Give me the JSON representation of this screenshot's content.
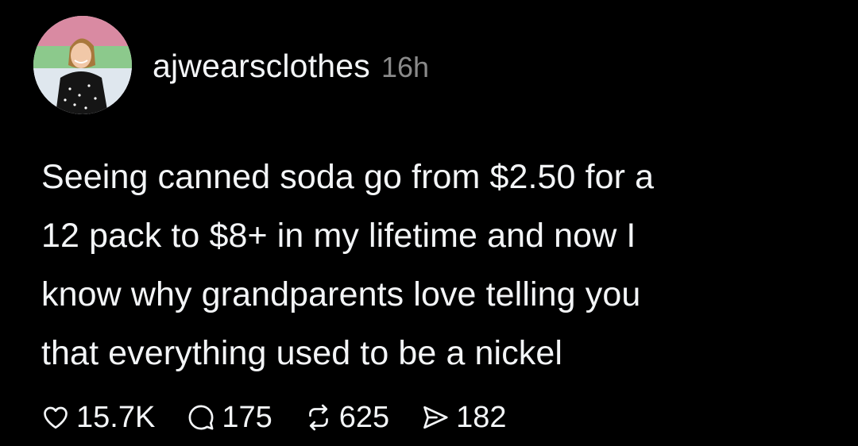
{
  "post": {
    "author": {
      "username": "ajwearsclothes",
      "avatar_icon": "profile-photo"
    },
    "timestamp": "16h",
    "text_lines": [
      "Seeing canned soda go from $2.50 for a",
      "12 pack to $8+ in my lifetime and now I",
      "know why grandparents love telling you",
      "that everything used to be a nickel"
    ],
    "actions": {
      "likes": {
        "icon": "heart-icon",
        "count": "15.7K"
      },
      "replies": {
        "icon": "comment-icon",
        "count": "175"
      },
      "reposts": {
        "icon": "repost-icon",
        "count": "625"
      },
      "shares": {
        "icon": "send-icon",
        "count": "182"
      }
    }
  },
  "colors": {
    "background": "#000000",
    "text_primary": "#f3f5f7",
    "text_secondary": "#8a8a8a"
  }
}
